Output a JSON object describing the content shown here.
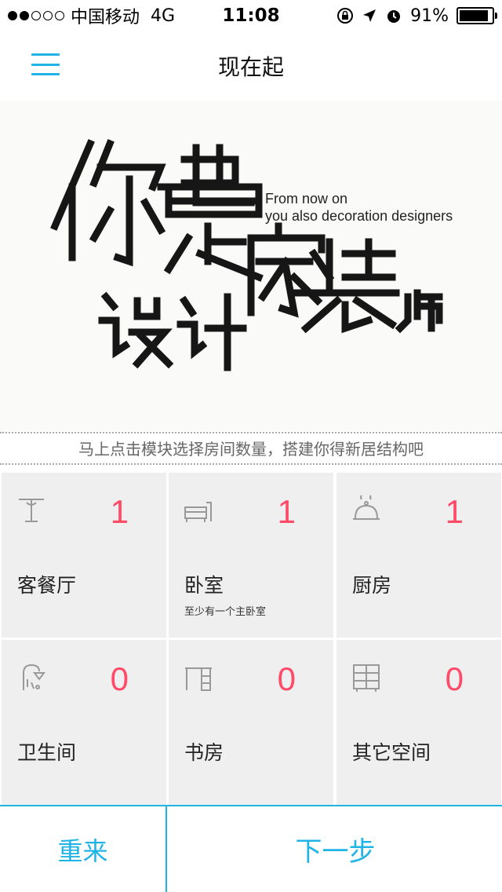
{
  "status": {
    "carrier": "中国移动",
    "network": "4G",
    "time": "11:08",
    "battery": "91%",
    "battery_level": 0.91
  },
  "nav": {
    "title": "现在起"
  },
  "hero": {
    "en_line1": "From now on",
    "en_line2": "you also decoration designers",
    "cn_text": "你也是家装设计师"
  },
  "hint": "马上点击模块选择房间数量，搭建你得新居结构吧",
  "rooms": [
    {
      "label": "客餐厅",
      "count": "1",
      "icon": "dining-table-icon",
      "sub": ""
    },
    {
      "label": "卧室",
      "count": "1",
      "icon": "bed-icon",
      "sub": "至少有一个主卧室"
    },
    {
      "label": "厨房",
      "count": "1",
      "icon": "cloche-icon",
      "sub": ""
    },
    {
      "label": "卫生间",
      "count": "0",
      "icon": "shower-icon",
      "sub": ""
    },
    {
      "label": "书房",
      "count": "0",
      "icon": "desk-icon",
      "sub": ""
    },
    {
      "label": "其它空间",
      "count": "0",
      "icon": "cabinet-icon",
      "sub": ""
    }
  ],
  "footer": {
    "reset": "重来",
    "next": "下一步"
  },
  "colors": {
    "accent": "#1fb3e6",
    "count": "#ff4a68",
    "cell_bg": "#efefef"
  }
}
